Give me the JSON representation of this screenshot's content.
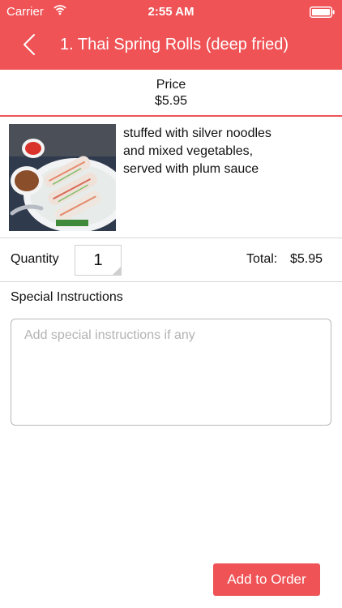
{
  "status_bar": {
    "carrier": "Carrier",
    "time": "2:55 AM",
    "icons": [
      "wifi-icon",
      "battery-icon"
    ]
  },
  "nav": {
    "back_icon": "chevron-left-icon",
    "title": "1. Thai Spring Rolls (deep fried)"
  },
  "price": {
    "label": "Price",
    "value": "$5.95"
  },
  "item": {
    "description_lines": [
      "stuffed with silver noodles",
      "and mixed vegetables,",
      "served with plum sauce"
    ]
  },
  "quantity": {
    "label": "Quantity",
    "value": "1"
  },
  "total": {
    "label": "Total:",
    "value": "$5.95"
  },
  "special_instructions": {
    "label": "Special Instructions",
    "placeholder": "Add special instructions if any"
  },
  "actions": {
    "add_to_order": "Add to Order"
  },
  "colors": {
    "accent": "#ef5356",
    "divider": "#d6d6d6",
    "placeholder_text": "#b3b3b3"
  }
}
